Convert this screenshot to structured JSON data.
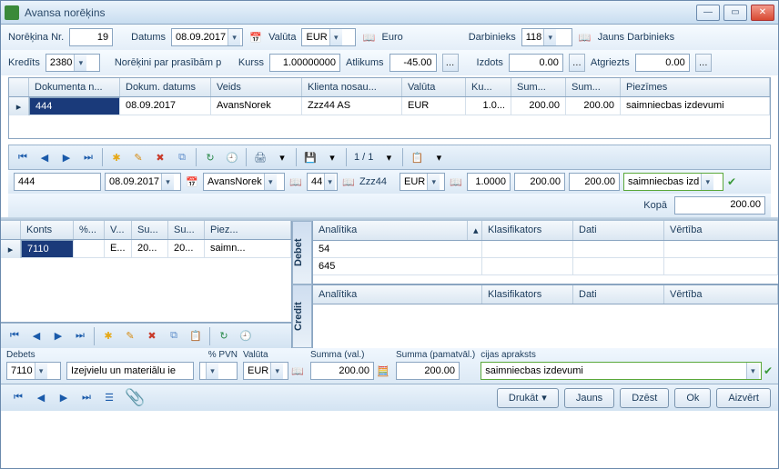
{
  "window": {
    "title": "Avansa norēķins"
  },
  "header": {
    "nr_label": "Norēķina Nr.",
    "nr_value": "19",
    "date_label": "Datums",
    "date_value": "08.09.2017",
    "currency_label": "Valūta",
    "currency_value": "EUR",
    "currency_name": "Euro",
    "employee_label": "Darbinieks",
    "employee_value": "118",
    "employee_name": "Jauns Darbinieks",
    "credit_label": "Kredīts",
    "credit_value": "2380",
    "credit_name": "Norēķini par prasībām p",
    "rate_label": "Kurss",
    "rate_value": "1.00000000",
    "balance_label": "Atlikums",
    "balance_value": "-45.00",
    "issued_label": "Izdots",
    "issued_value": "0.00",
    "returned_label": "Atgriezts",
    "returned_value": "0.00"
  },
  "main_grid": {
    "columns": [
      "Dokumenta n...",
      "Dokum. datums",
      "Veids",
      "Klienta nosau...",
      "Valūta",
      "Ku...",
      "Sum...",
      "Sum...",
      "Piezīmes"
    ],
    "rows": [
      {
        "doc_no": "444",
        "doc_date": "08.09.2017",
        "type": "AvansNorek",
        "client": "Zzz44 AS",
        "currency": "EUR",
        "rate": "1.0...",
        "sum1": "200.00",
        "sum2": "200.00",
        "notes": "saimniecbas izdevumi"
      }
    ]
  },
  "pager": {
    "text": "1 / 1"
  },
  "edit_row": {
    "doc_no": "444",
    "doc_date": "08.09.2017",
    "type": "AvansNorek",
    "client_id": "44",
    "client_name": "Zzz44",
    "currency": "EUR",
    "rate": "1.0000",
    "sum1": "200.00",
    "sum2": "200.00",
    "notes": "saimniecbas izd"
  },
  "totals": {
    "label": "Kopā",
    "value": "200.00"
  },
  "left_grid": {
    "columns": [
      "Konts",
      "%...",
      "V...",
      "Su...",
      "Su...",
      "Piez..."
    ],
    "rows": [
      {
        "account": "7110",
        "pct": "",
        "v": "E...",
        "s1": "20...",
        "s2": "20...",
        "notes": "saimn..."
      }
    ]
  },
  "debet": {
    "label": "Debet",
    "columns": [
      "Analītika",
      "Klasifikators",
      "Dati",
      "Vērtība"
    ],
    "rows": [
      {
        "a": "54"
      },
      {
        "a": "645"
      }
    ]
  },
  "credit": {
    "label": "Credit",
    "columns": [
      "Analītika",
      "Klasifikators",
      "Dati",
      "Vērtība"
    ]
  },
  "bottom": {
    "debets_label": "Debets",
    "debets_value": "7110",
    "desc_value": "Izejvielu un materiālu ie",
    "pvn_label": "% PVN",
    "pvn_value": "",
    "currency_label": "Valūta",
    "currency_value": "EUR",
    "sum_val_label": "Summa (val.)",
    "sum_val_value": "200.00",
    "sum_base_label": "Summa (pamatvāl.)",
    "sum_base_value": "200.00",
    "op_desc_label": "cijas apraksts",
    "op_desc_value": "saimniecbas izdevumi"
  },
  "footer": {
    "print": "Drukāt",
    "new": "Jauns",
    "delete": "Dzēst",
    "ok": "Ok",
    "close": "Aizvērt"
  }
}
